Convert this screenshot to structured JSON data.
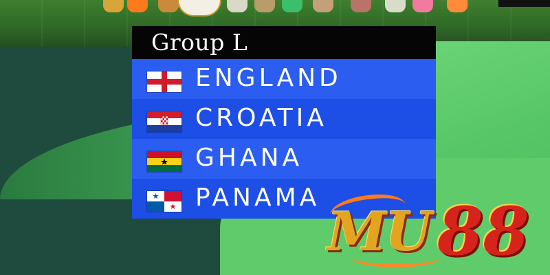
{
  "card": {
    "title": "Group L",
    "teams": [
      {
        "name": "ENGLAND",
        "flag_icon": "england-flag-icon"
      },
      {
        "name": "CROATIA",
        "flag_icon": "croatia-flag-icon"
      },
      {
        "name": "GHANA",
        "flag_icon": "ghana-flag-icon"
      },
      {
        "name": "PANAMA",
        "flag_icon": "panama-flag-icon"
      }
    ]
  },
  "logo": {
    "text_mu": "MU",
    "text_88": "88"
  },
  "colors": {
    "header_bg": "#050505",
    "row_light": "#2a5df0",
    "row_dark": "#1d4ee6",
    "logo_gold": "#e3a51f",
    "logo_red": "#d6241c"
  }
}
